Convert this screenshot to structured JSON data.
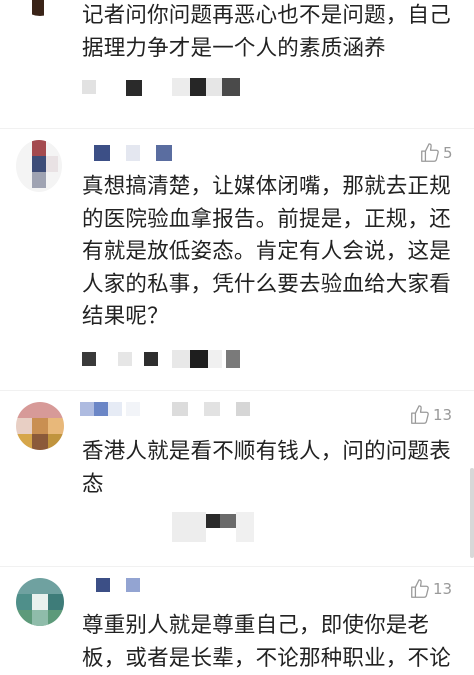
{
  "comments": [
    {
      "text_lines": [
        "记者问你问题再恶心也不是问题，自己",
        "据理力争才是一个人的素质涵养"
      ]
    },
    {
      "like_count": "5",
      "text_lines": [
        "真想搞清楚，让媒体闭嘴，那就去正规",
        "的医院验血拿报告。前提是，正规，还",
        "有就是放低姿态。肯定有人会说，这是",
        "人家的私事，凭什么要去验血给大家看",
        "结果呢？"
      ]
    },
    {
      "like_count": "13",
      "text_lines": [
        "香港人就是看不顺有钱人，问的问题表",
        "态"
      ]
    },
    {
      "like_count": "13",
      "text_lines": [
        "尊重别人就是尊重自己，即使你是老",
        "板，或者是长辈，不论那种职业，不论"
      ]
    }
  ],
  "icons": {
    "like": "thumbs-up-icon"
  },
  "colors": {
    "text": "#222222",
    "meta": "#9a9a9a"
  }
}
